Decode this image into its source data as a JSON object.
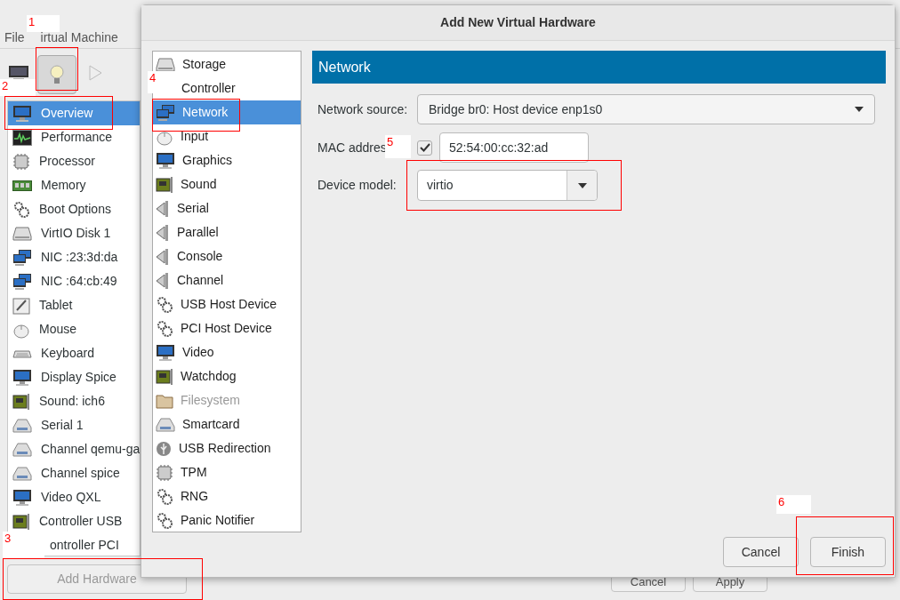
{
  "main_window": {
    "menu": [
      "File",
      "irtual Machine"
    ],
    "toolbar": [
      {
        "kind": "console",
        "pressed": false
      },
      {
        "kind": "details",
        "pressed": true
      },
      {
        "kind": "play",
        "pressed": false
      }
    ],
    "sidebar": {
      "items": [
        {
          "label": "Overview",
          "selected": true
        },
        {
          "label": "Performance",
          "selected": false
        },
        {
          "label": "Processor",
          "selected": false
        },
        {
          "label": "Memory",
          "selected": false
        },
        {
          "label": "Boot Options",
          "selected": false
        },
        {
          "label": "VirtIO Disk 1",
          "selected": false
        },
        {
          "label": "NIC :23:3d:da",
          "selected": false
        },
        {
          "label": "NIC :64:cb:49",
          "selected": false
        },
        {
          "label": "Tablet",
          "selected": false
        },
        {
          "label": "Mouse",
          "selected": false
        },
        {
          "label": "Keyboard",
          "selected": false
        },
        {
          "label": "Display Spice",
          "selected": false
        },
        {
          "label": "Sound: ich6",
          "selected": false
        },
        {
          "label": "Serial 1",
          "selected": false
        },
        {
          "label": "Channel qemu-ga",
          "selected": false
        },
        {
          "label": "Channel spice",
          "selected": false
        },
        {
          "label": "Video QXL",
          "selected": false
        },
        {
          "label": "Controller USB",
          "selected": false
        },
        {
          "label": "ontroller PCI",
          "selected": false
        }
      ]
    },
    "add_button": "Add Hardware",
    "footer_buttons": [
      "Cancel",
      "Apply"
    ]
  },
  "dialog": {
    "title": "Add New Virtual Hardware",
    "types": [
      {
        "label": "Storage",
        "selected": false,
        "disabled": false
      },
      {
        "label": "Controller",
        "selected": false,
        "disabled": false
      },
      {
        "label": "Network",
        "selected": true,
        "disabled": false
      },
      {
        "label": "Input",
        "selected": false,
        "disabled": false
      },
      {
        "label": "Graphics",
        "selected": false,
        "disabled": false
      },
      {
        "label": "Sound",
        "selected": false,
        "disabled": false
      },
      {
        "label": "Serial",
        "selected": false,
        "disabled": false
      },
      {
        "label": "Parallel",
        "selected": false,
        "disabled": false
      },
      {
        "label": "Console",
        "selected": false,
        "disabled": false
      },
      {
        "label": "Channel",
        "selected": false,
        "disabled": false
      },
      {
        "label": "USB Host Device",
        "selected": false,
        "disabled": false
      },
      {
        "label": "PCI Host Device",
        "selected": false,
        "disabled": false
      },
      {
        "label": "Video",
        "selected": false,
        "disabled": false
      },
      {
        "label": "Watchdog",
        "selected": false,
        "disabled": false
      },
      {
        "label": "Filesystem",
        "selected": false,
        "disabled": true
      },
      {
        "label": "Smartcard",
        "selected": false,
        "disabled": false
      },
      {
        "label": "USB Redirection",
        "selected": false,
        "disabled": false
      },
      {
        "label": "TPM",
        "selected": false,
        "disabled": false
      },
      {
        "label": "RNG",
        "selected": false,
        "disabled": false
      },
      {
        "label": "Panic Notifier",
        "selected": false,
        "disabled": false
      }
    ],
    "panel_title": "Network",
    "network_source": {
      "label": "Network source:",
      "value": "Bridge br0: Host device enp1s0"
    },
    "mac_address": {
      "label": "MAC addres",
      "checked": true,
      "value": "52:54:00:cc:32:ad"
    },
    "device_model": {
      "label": "Device model:",
      "value": "virtio"
    },
    "buttons": [
      "Cancel",
      "Finish"
    ]
  },
  "annotations": [
    "1",
    "2",
    "3",
    "4",
    "5",
    "6"
  ]
}
